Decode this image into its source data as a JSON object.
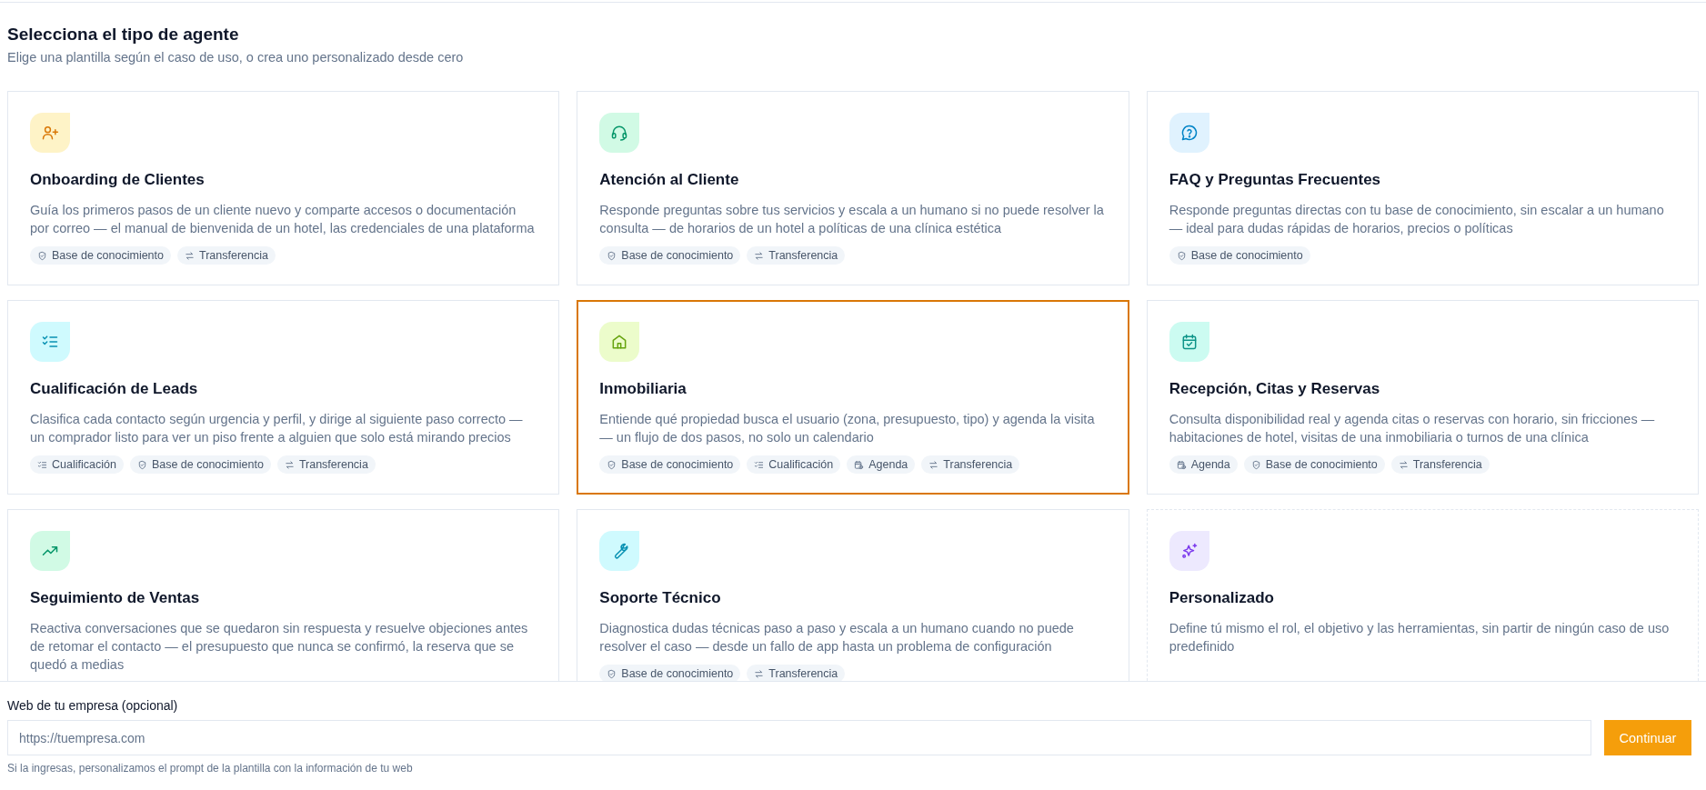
{
  "header": {
    "title": "Selecciona el tipo de agente",
    "subtitle": "Elige una plantilla según el caso de uso, o crea uno personalizado desde cero"
  },
  "cards": [
    {
      "kind": "template",
      "title": "Onboarding de Clientes",
      "description": "Guía los primeros pasos de un cliente nuevo y comparte accesos o documentación por correo — el manual de bienvenida de un hotel, las credenciales de una plataforma",
      "selected": false,
      "tags": [
        {
          "kind": "knowledge",
          "label": "Base de conocimiento"
        },
        {
          "kind": "transfer",
          "label": "Transferencia"
        }
      ]
    },
    {
      "kind": "template",
      "title": "Atención al Cliente",
      "description": "Responde preguntas sobre tus servicios y escala a un humano si no puede resolver la consulta — de horarios de un hotel a políticas de una clínica estética",
      "selected": false,
      "tags": [
        {
          "kind": "knowledge",
          "label": "Base de conocimiento"
        },
        {
          "kind": "transfer",
          "label": "Transferencia"
        }
      ]
    },
    {
      "kind": "template",
      "title": "FAQ y Preguntas Frecuentes",
      "description": "Responde preguntas directas con tu base de conocimiento, sin escalar a un humano — ideal para dudas rápidas de horarios, precios o políticas",
      "selected": false,
      "tags": [
        {
          "kind": "knowledge",
          "label": "Base de conocimiento"
        }
      ]
    },
    {
      "kind": "template",
      "title": "Cualificación de Leads",
      "description": "Clasifica cada contacto según urgencia y perfil, y dirige al siguiente paso correcto — un comprador listo para ver un piso frente a alguien que solo está mirando precios",
      "selected": false,
      "tags": [
        {
          "kind": "qualification",
          "label": "Cualificación"
        },
        {
          "kind": "knowledge",
          "label": "Base de conocimiento"
        },
        {
          "kind": "transfer",
          "label": "Transferencia"
        }
      ]
    },
    {
      "kind": "template",
      "title": "Inmobiliaria",
      "description": "Entiende qué propiedad busca el usuario (zona, presupuesto, tipo) y agenda la visita — un flujo de dos pasos, no solo un calendario",
      "selected": true,
      "tags": [
        {
          "kind": "knowledge",
          "label": "Base de conocimiento"
        },
        {
          "kind": "qualification",
          "label": "Cualificación"
        },
        {
          "kind": "schedule",
          "label": "Agenda"
        },
        {
          "kind": "transfer",
          "label": "Transferencia"
        }
      ]
    },
    {
      "kind": "template",
      "title": "Recepción, Citas y Reservas",
      "description": "Consulta disponibilidad real y agenda citas o reservas con horario, sin fricciones — habitaciones de hotel, visitas de una inmobiliaria o turnos de una clínica",
      "selected": false,
      "tags": [
        {
          "kind": "schedule",
          "label": "Agenda"
        },
        {
          "kind": "knowledge",
          "label": "Base de conocimiento"
        },
        {
          "kind": "transfer",
          "label": "Transferencia"
        }
      ]
    },
    {
      "kind": "template",
      "title": "Seguimiento de Ventas",
      "description": "Reactiva conversaciones que se quedaron sin respuesta y resuelve objeciones antes de retomar el contacto — el presupuesto que nunca se confirmó, la reserva que se quedó a medias",
      "selected": false
    },
    {
      "kind": "template",
      "title": "Soporte Técnico",
      "description": "Diagnostica dudas técnicas paso a paso y escala a un humano cuando no puede resolver el caso — desde un fallo de app hasta un problema de configuración",
      "selected": false,
      "tags": [
        {
          "kind": "knowledge",
          "label": "Base de conocimiento"
        },
        {
          "kind": "transfer",
          "label": "Transferencia"
        }
      ]
    },
    {
      "kind": "custom",
      "title": "Personalizado",
      "description": "Define tú mismo el rol, el objetivo y las herramientas, sin partir de ningún caso de uso predefinido",
      "selected": false
    }
  ],
  "footer": {
    "label": "Web de tu empresa (opcional)",
    "placeholder": "https://tuempresa.com",
    "button": "Continuar",
    "hint": "Si la ingresas, personalizamos el prompt de la plantilla con la información de tu web"
  }
}
